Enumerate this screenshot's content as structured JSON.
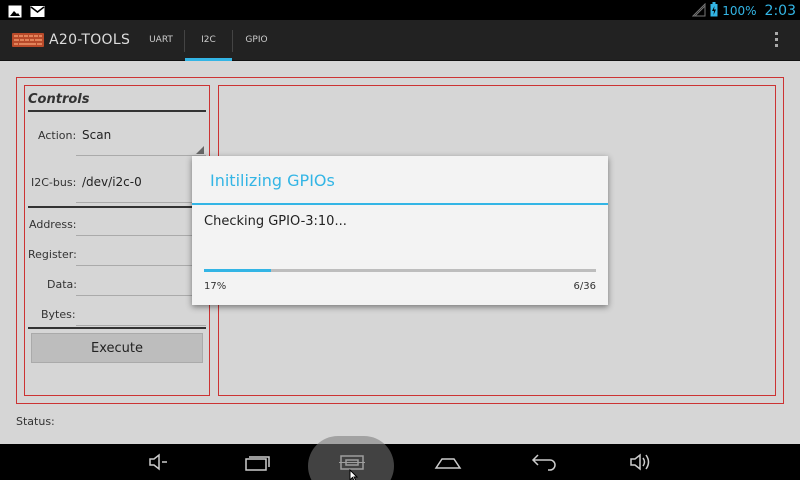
{
  "statusbar": {
    "battery": "100%",
    "time": "2:03",
    "icons": [
      "picture-icon",
      "gmail-icon",
      "no-signal-icon",
      "battery-charging-icon"
    ]
  },
  "actionbar": {
    "app_title": "A20-TOOLS",
    "tabs": [
      {
        "label": "UART",
        "selected": false
      },
      {
        "label": "I2C",
        "selected": true
      },
      {
        "label": "GPIO",
        "selected": false
      }
    ],
    "accent": "#33b5e5"
  },
  "controls": {
    "title": "Controls",
    "action_label": "Action:",
    "action_value": "Scan",
    "bus_label": "I2C-bus:",
    "bus_value": "/dev/i2c-0",
    "address_label": "Address:",
    "register_label": "Register:",
    "data_label": "Data:",
    "bytes_label": "Bytes:",
    "execute_label": "Execute"
  },
  "status": {
    "label": "Status:"
  },
  "dialog": {
    "title": "Initilizing GPIOs",
    "message": "Checking GPIO-3:10...",
    "percent_text": "17%",
    "count_text": "6/36",
    "progress": 0.17
  },
  "navbar": {
    "buttons": [
      "volume-down-icon",
      "recent-apps-icon",
      "screenshot-icon",
      "home-icon",
      "back-icon",
      "volume-up-icon"
    ]
  }
}
